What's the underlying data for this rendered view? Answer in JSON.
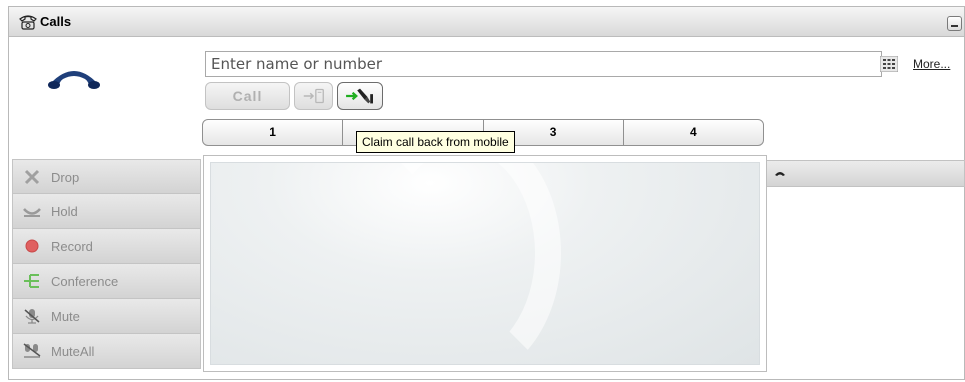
{
  "panel": {
    "title": "Calls",
    "title_icon": "phone-handset-outline-icon",
    "minimize_icon": "minimize-icon"
  },
  "dialer": {
    "placeholder": "Enter name or number",
    "value": "",
    "keypad_icon": "keypad-grid-icon",
    "more_label": "More..."
  },
  "buttons": {
    "call_label": "Call",
    "transfer_icon": "transfer-to-mobile-icon",
    "claim_icon": "claim-call-back-icon"
  },
  "tooltip": {
    "text": "Claim call back from mobile"
  },
  "tabs": [
    {
      "label": "1"
    },
    {
      "label": ""
    },
    {
      "label": "3"
    },
    {
      "label": "4"
    }
  ],
  "actions": [
    {
      "label": "Drop",
      "icon": "drop-x-icon"
    },
    {
      "label": "Hold",
      "icon": "hold-icon"
    },
    {
      "label": "Record",
      "icon": "record-icon"
    },
    {
      "label": "Conference",
      "icon": "conference-icon"
    },
    {
      "label": "Mute",
      "icon": "mute-icon"
    },
    {
      "label": "MuteAll",
      "icon": "mute-all-icon"
    }
  ],
  "colors": {
    "phone_icon": "#1f3f7a",
    "record_red": "#e06060",
    "conference_green": "#6abf5a",
    "claim_green": "#1fae1f",
    "tooltip_bg": "#ffffe1"
  }
}
